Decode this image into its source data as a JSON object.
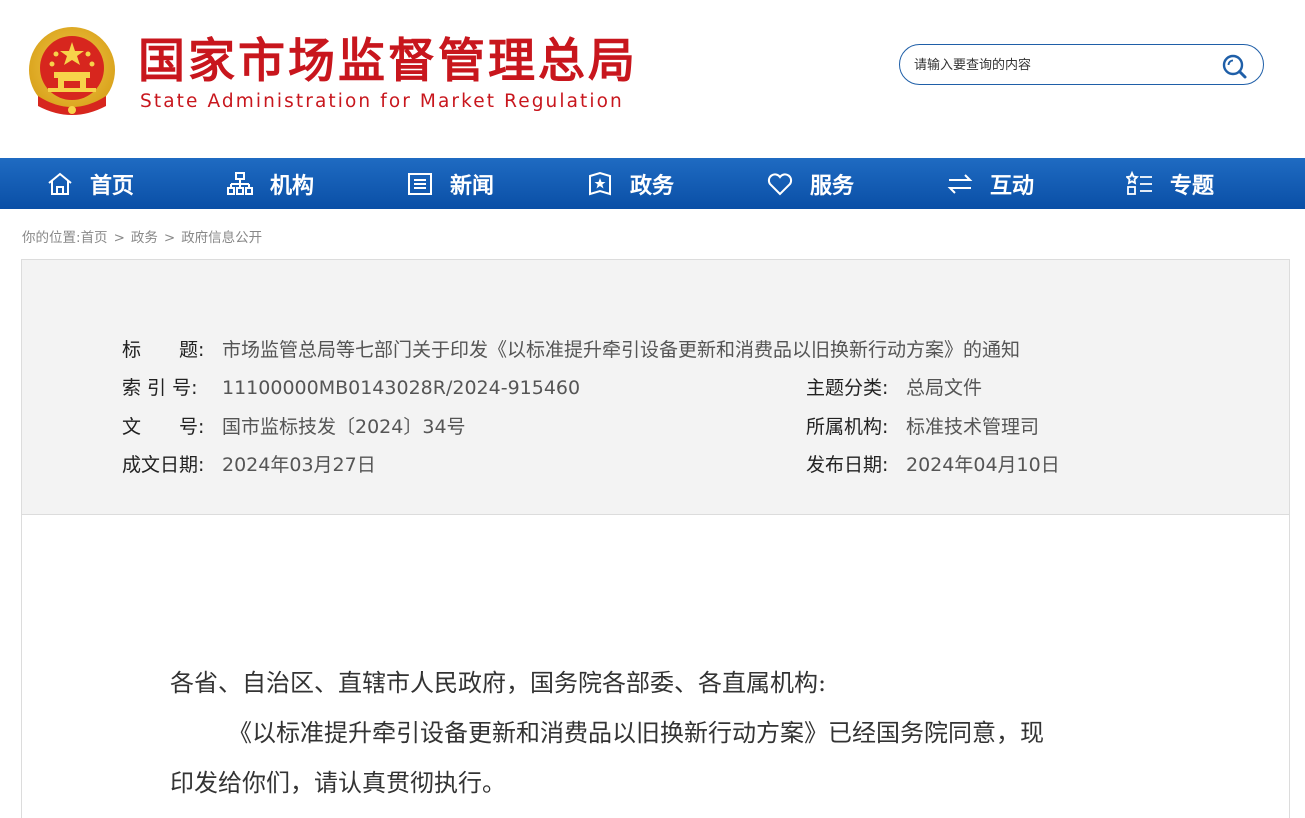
{
  "header": {
    "title_cn": "国家市场监督管理总局",
    "title_en": "State Administration for Market Regulation",
    "search_placeholder": "请输入要查询的内容"
  },
  "nav": {
    "items": [
      {
        "label": "首页",
        "icon": "home-icon"
      },
      {
        "label": "机构",
        "icon": "org-chart-icon"
      },
      {
        "label": "新闻",
        "icon": "news-icon"
      },
      {
        "label": "政务",
        "icon": "government-affairs-icon"
      },
      {
        "label": "服务",
        "icon": "heart-icon"
      },
      {
        "label": "互动",
        "icon": "exchange-arrows-icon"
      },
      {
        "label": "专题",
        "icon": "topic-list-icon"
      }
    ]
  },
  "breadcrumb": {
    "prefix": "你的位置:",
    "items": [
      "首页",
      "政务",
      "政府信息公开"
    ],
    "separator": ">"
  },
  "meta": {
    "title_label": "标　　题:",
    "title_value": "市场监管总局等七部门关于印发《以标准提升牵引设备更新和消费品以旧换新行动方案》的通知",
    "index_label": "索 引 号:",
    "index_value": "11100000MB0143028R/2024-915460",
    "category_label": "主题分类:",
    "category_value": "总局文件",
    "doc_no_label": "文　　号:",
    "doc_no_value": "国市监标技发〔2024〕34号",
    "org_label": "所属机构:",
    "org_value": "标准技术管理司",
    "written_label": "成文日期:",
    "written_value": "2024年03月27日",
    "published_label": "发布日期:",
    "published_value": "2024年04月10日"
  },
  "document": {
    "salutation": "各省、自治区、直辖市人民政府，国务院各部委、各直属机构:",
    "paragraph1_line1": "《以标准提升牵引设备更新和消费品以旧换新行动方案》已经国务院同意，现",
    "paragraph1_line2": "印发给你们，请认真贯彻执行。"
  },
  "colors": {
    "brand_red": "#c8161d",
    "nav_blue": "#0a4fa6",
    "meta_bg": "#f3f3f3"
  }
}
